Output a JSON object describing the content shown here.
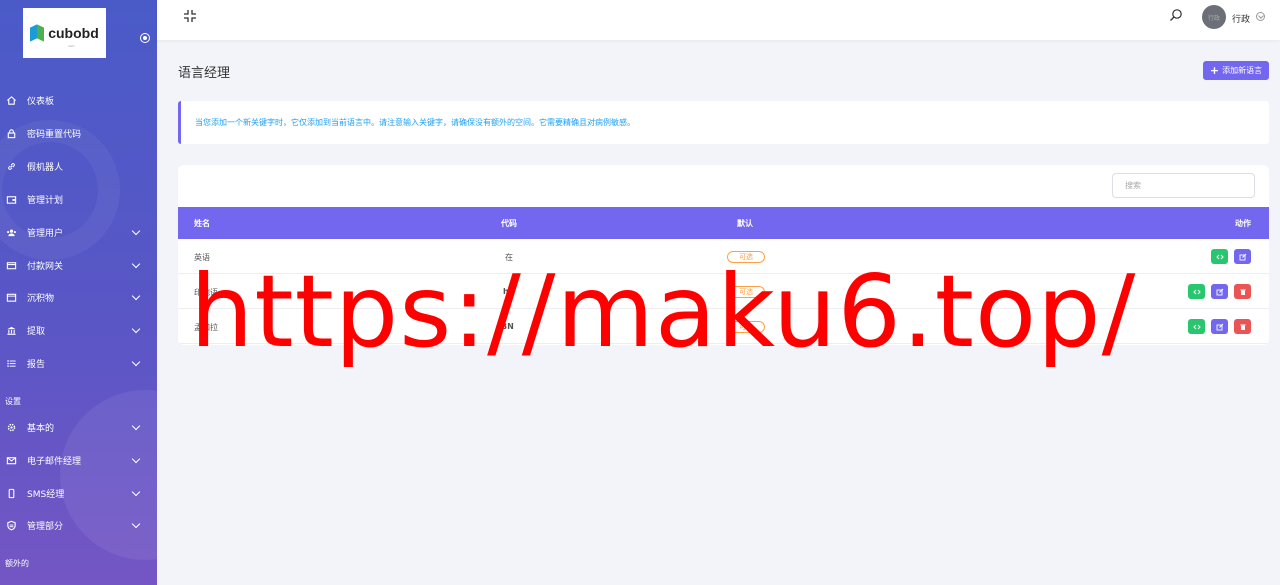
{
  "brand": {
    "logo_text": "cubobd",
    "logo_sub": "com"
  },
  "sidebar": {
    "items": [
      {
        "label": "仪表板",
        "icon": "home-icon",
        "has_children": false
      },
      {
        "label": "密码重置代码",
        "icon": "lock-icon",
        "has_children": false
      },
      {
        "label": "假机器人",
        "icon": "link-icon",
        "has_children": false
      },
      {
        "label": "管理计划",
        "icon": "wallet-icon",
        "has_children": false
      },
      {
        "label": "管理用户",
        "icon": "users-icon",
        "has_children": true
      },
      {
        "label": "付款网关",
        "icon": "card-icon",
        "has_children": true
      },
      {
        "label": "沉积物",
        "icon": "deposit-icon",
        "has_children": true
      },
      {
        "label": "提取",
        "icon": "bank-icon",
        "has_children": true
      },
      {
        "label": "报告",
        "icon": "list-icon",
        "has_children": true
      }
    ],
    "section_settings": "设置",
    "settings_items": [
      {
        "label": "基本的",
        "icon": "gear-icon",
        "has_children": true
      },
      {
        "label": "电子邮件经理",
        "icon": "mail-icon",
        "has_children": true
      },
      {
        "label": "SMS经理",
        "icon": "phone-icon",
        "has_children": true
      },
      {
        "label": "管理部分",
        "icon": "shield-icon",
        "has_children": true
      }
    ],
    "section_extra": "额外的"
  },
  "topbar": {
    "user_name": "行政",
    "avatar_text": "行政"
  },
  "page": {
    "title": "语言经理",
    "add_button": "添加新语言",
    "alert": "当您添加一个新关键字时，它仅添加到当前语言中。请注意输入关键字，请确保没有额外的空间。它需要精确且对病例敏感。",
    "search_placeholder": "搜索"
  },
  "table": {
    "headers": [
      "姓名",
      "代码",
      "默认",
      "动作"
    ],
    "rows": [
      {
        "name": "英语",
        "code": "在",
        "default": "可选",
        "actions": [
          "code",
          "edit"
        ]
      },
      {
        "name": "印地语",
        "code": "hn",
        "default": "可选",
        "actions": [
          "code",
          "edit",
          "delete"
        ]
      },
      {
        "name": "孟加拉",
        "code": "BN",
        "default": "可选",
        "actions": [
          "code",
          "edit",
          "delete"
        ]
      }
    ]
  },
  "watermark": "https://maku6.top/",
  "colors": {
    "primary": "#7367f0",
    "success": "#28c76f",
    "danger": "#ea5455",
    "warning": "#ff9f43",
    "info": "#1e9ff2"
  }
}
